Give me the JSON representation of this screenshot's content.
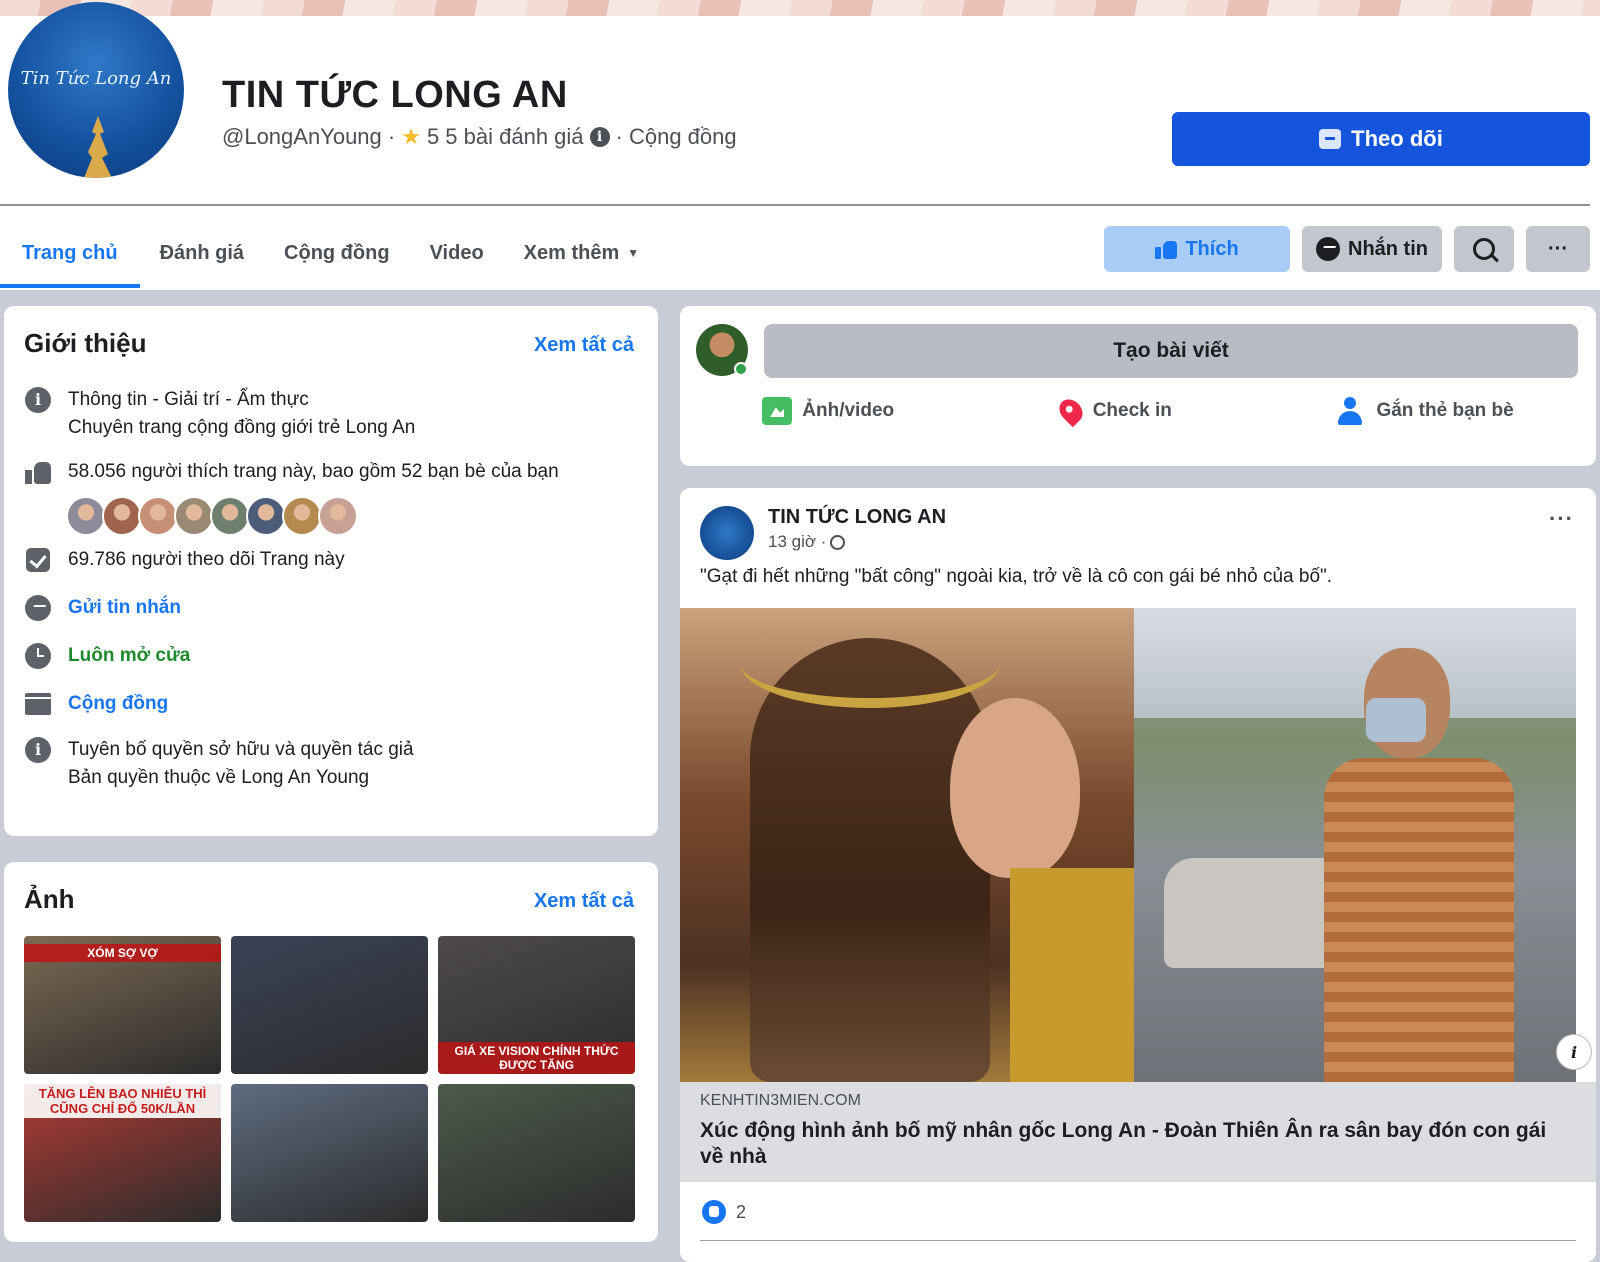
{
  "header": {
    "avatar_text": "Tin Tức Long An",
    "title": "TIN TỨC LONG AN",
    "handle": "@LongAnYoung ·",
    "rating": "5 5 bài đánh giá",
    "category": "· Cộng đồng",
    "follow_label": "Theo dõi"
  },
  "nav": {
    "tabs": [
      {
        "label": "Trang chủ"
      },
      {
        "label": "Đánh giá"
      },
      {
        "label": "Cộng đồng"
      },
      {
        "label": "Video"
      },
      {
        "label": "Xem thêm"
      }
    ],
    "like_label": "Thích",
    "message_label": "Nhắn tin",
    "more_label": "···"
  },
  "intro": {
    "title": "Giới thiệu",
    "see_all": "Xem tất cả",
    "category_line": "Thông tin - Giải trí - Ẩm thực",
    "description": "Chuyên trang cộng đồng giới trẻ Long An",
    "likes": "58.056 người thích trang này, bao gồm 52 bạn bè của bạn",
    "followers": "69.786 người theo dõi Trang này",
    "send_message": "Gửi tin nhắn",
    "open_status": "Luôn mở cửa",
    "category_link": "Cộng đồng",
    "copyright_line1": "Tuyên bố quyền sở hữu và quyền tác giả",
    "copyright_line2": "Bản quyền thuộc về Long An Young",
    "friend_colors": [
      "#8d8a9a",
      "#a0644e",
      "#c78f73",
      "#9b8a73",
      "#6f7f6d",
      "#4c5d7a",
      "#b58a4f",
      "#c8a195"
    ]
  },
  "photos": {
    "title": "Ảnh",
    "see_all": "Xem tất cả",
    "items": [
      {
        "caption": "XÓM SỢ VỢ",
        "color": "#7c6a52"
      },
      {
        "caption": "",
        "color": "#3a4256"
      },
      {
        "caption": "GIÁ XE VISION CHÍNH THỨC ĐƯỢC TĂNG",
        "color": "#4e4a4c"
      },
      {
        "caption": "TĂNG LÊN BAO NHIÊU THÌ CŨNG CHỈ ĐỔ 50K/LẦN",
        "color": "#b23a33"
      },
      {
        "caption": "",
        "color": "#5e6c80"
      },
      {
        "caption": "",
        "color": "#4c5a4a"
      }
    ]
  },
  "composer": {
    "create_post": "Tạo bài viết",
    "photo_video": "Ảnh/video",
    "check_in": "Check in",
    "tag_friends": "Gắn thẻ bạn bè"
  },
  "post": {
    "author": "TIN TỨC LONG AN",
    "time": "13 giờ ·",
    "text": "\"Gạt đi hết những \"bất công\" ngoài kia, trở về là cô con gái bé nhỏ của bố\".",
    "link_domain": "KENHTIN3MIEN.COM",
    "link_title": "Xúc động hình ảnh bố mỹ nhân gốc Long An - Đoàn Thiên Ân ra sân bay đón con gái về nhà",
    "reaction_count": "2"
  }
}
